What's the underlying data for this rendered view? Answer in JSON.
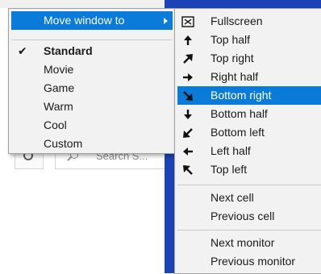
{
  "background": {
    "search_placeholder": "Search S..."
  },
  "main_menu": {
    "move_window_label": "Move window to",
    "items": [
      {
        "label": "Standard",
        "checked": true
      },
      {
        "label": "Movie"
      },
      {
        "label": "Game"
      },
      {
        "label": "Warm"
      },
      {
        "label": "Cool"
      },
      {
        "label": "Custom"
      }
    ]
  },
  "sub_menu": {
    "items": [
      {
        "label": "Fullscreen",
        "icon": "fullscreen-icon"
      },
      {
        "label": "Top half",
        "icon": "arrow-up-icon"
      },
      {
        "label": "Top right",
        "icon": "arrow-up-right-icon"
      },
      {
        "label": "Right half",
        "icon": "arrow-right-icon"
      },
      {
        "label": "Bottom right",
        "icon": "arrow-down-right-icon",
        "highlighted": true
      },
      {
        "label": "Bottom half",
        "icon": "arrow-down-icon"
      },
      {
        "label": "Bottom left",
        "icon": "arrow-down-left-icon"
      },
      {
        "label": "Left half",
        "icon": "arrow-left-icon"
      },
      {
        "label": "Top left",
        "icon": "arrow-up-left-icon"
      }
    ],
    "cell_items": [
      {
        "label": "Next cell"
      },
      {
        "label": "Previous cell"
      }
    ],
    "monitor_items": [
      {
        "label": "Next monitor"
      },
      {
        "label": "Previous monitor"
      }
    ]
  },
  "colors": {
    "highlight": "#0a7bd8",
    "desktop_blue": "#1b43b5",
    "menu_background": "#f2f2f2"
  }
}
